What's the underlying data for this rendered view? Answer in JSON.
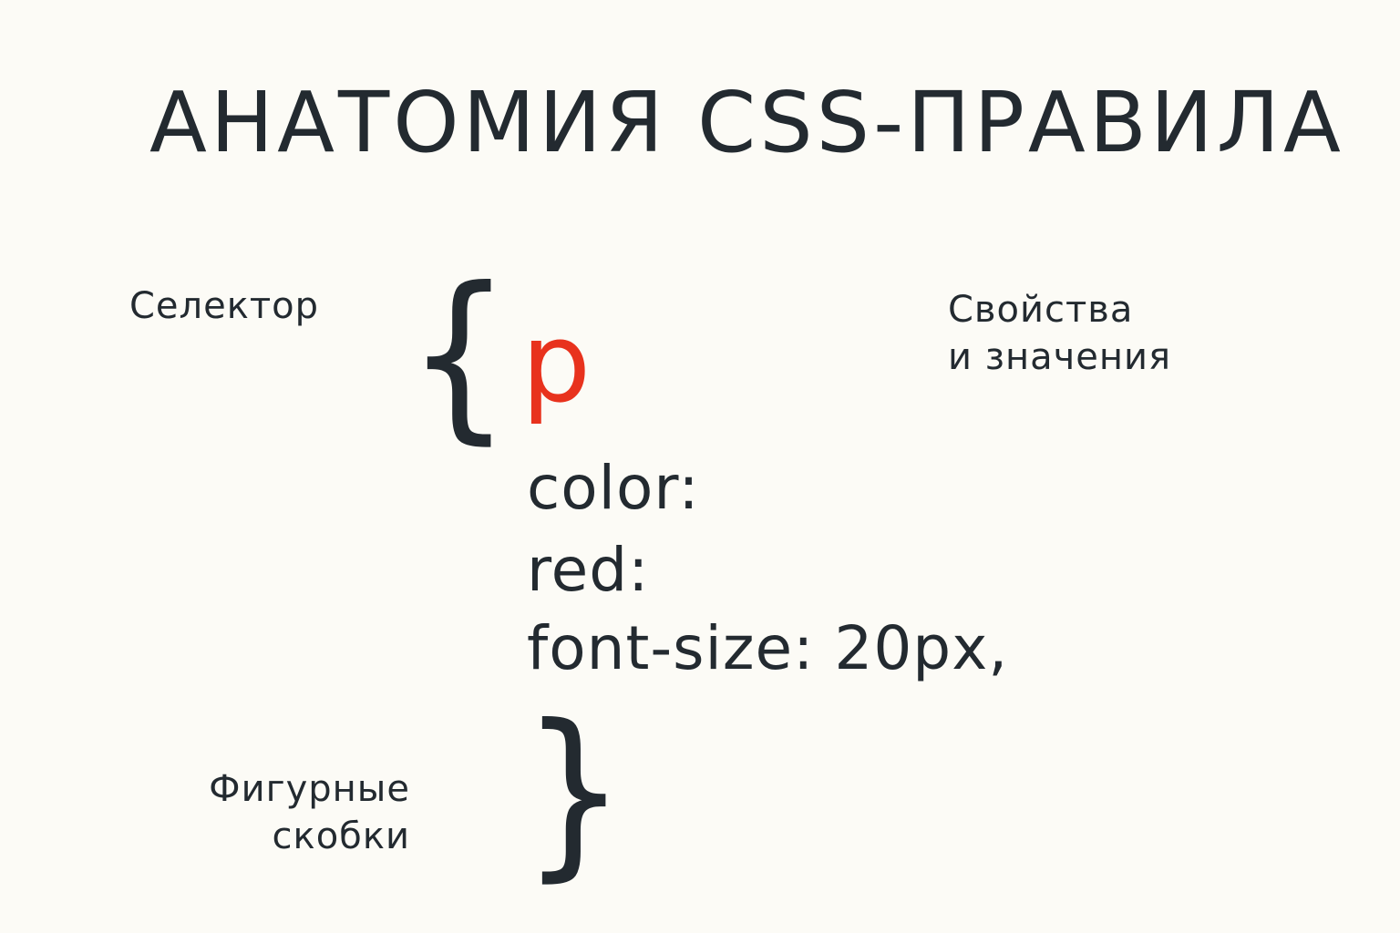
{
  "title": "АНАТОМИЯ CSS-ПРАВИЛА",
  "labels": {
    "selector": "Селектор",
    "properties_line1": "Свойства",
    "properties_line2": "и значения",
    "braces_line1": "Фигурные",
    "braces_line2": "скобки"
  },
  "code": {
    "open_brace": "{",
    "selector": "p",
    "lines": [
      "color:",
      "red:",
      "font-size:  20px,"
    ],
    "close_brace": "}"
  },
  "colors": {
    "background": "#fcfbf6",
    "text": "#232a30",
    "selector_accent": "#e8321d"
  }
}
